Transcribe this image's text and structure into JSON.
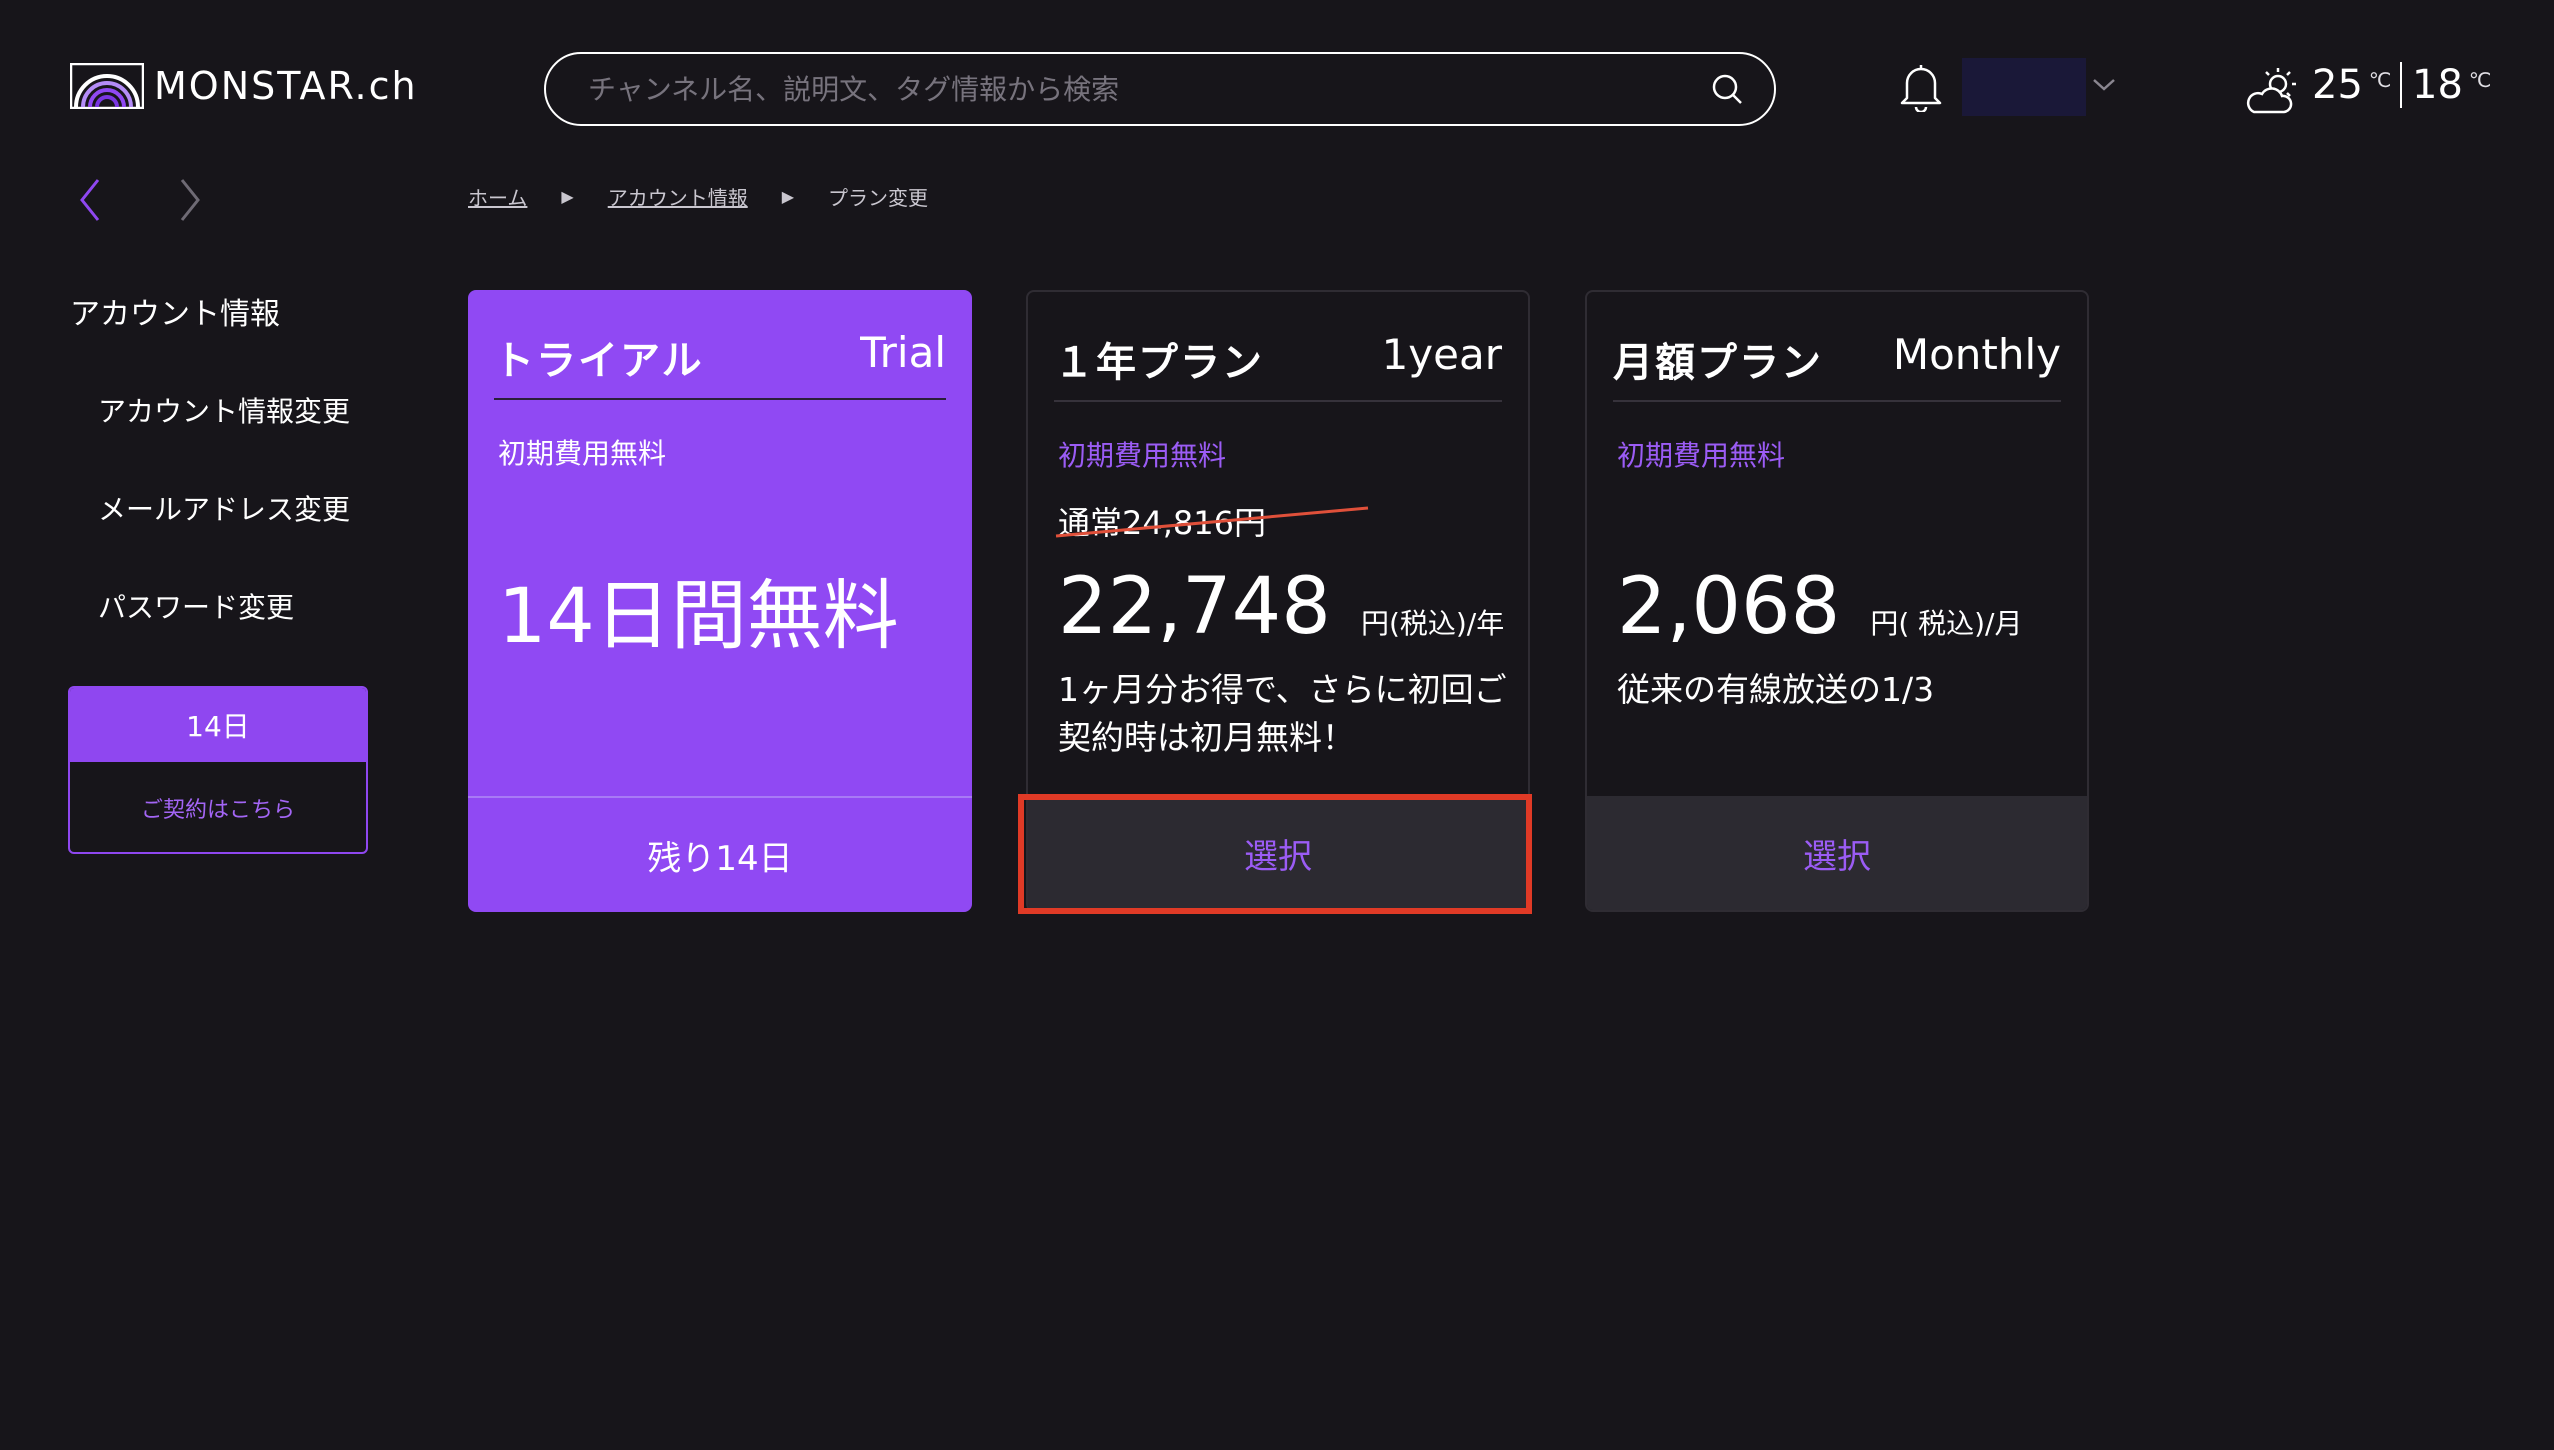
{
  "header": {
    "logo_text": "MONSTAR.ch",
    "search_placeholder": "チャンネル名、説明文、タグ情報から検索",
    "weather": {
      "high": "25",
      "low": "18",
      "unit": "℃"
    }
  },
  "breadcrumb": {
    "items": [
      "ホーム",
      "アカウント情報",
      "プラン変更"
    ],
    "separator": "▶"
  },
  "sidebar": {
    "title": "アカウント情報",
    "items": [
      "アカウント情報変更",
      "メールアドレス変更",
      "パスワード変更"
    ],
    "trial_days": "14日",
    "contract_link": "ご契約はこちら"
  },
  "plans": {
    "trial": {
      "name": "トライアル",
      "name_en": "Trial",
      "fee": "初期費用無料",
      "headline": "14日間無料",
      "footer": "残り14日"
    },
    "year": {
      "name": "１年プラン",
      "name_en": "1year",
      "fee": "初期費用無料",
      "regular": "通常24,816円",
      "price": "22,748",
      "unit": "円(税込)/年",
      "desc": "1ヶ月分お得で、さらに初回ご契約時は初月無料！",
      "button": "選択"
    },
    "month": {
      "name": "月額プラン",
      "name_en": "Monthly",
      "fee": "初期費用無料",
      "price": "2,068",
      "unit": "円( 税込)/月",
      "desc": "従来の有線放送の1/3",
      "button": "選択"
    }
  },
  "colors": {
    "background": "#17151a",
    "accent": "#9049f3",
    "highlight": "#e03a26"
  }
}
